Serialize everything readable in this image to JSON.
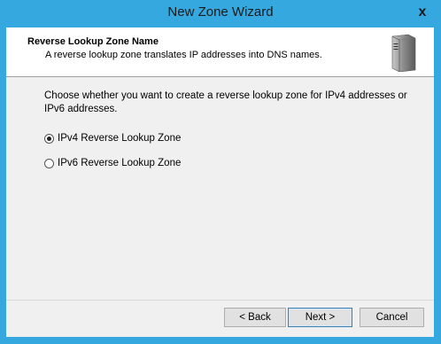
{
  "window": {
    "title": "New Zone Wizard",
    "close_glyph": "x"
  },
  "header": {
    "title": "Reverse Lookup Zone Name",
    "subtitle": "A reverse lookup zone translates IP addresses into DNS names.",
    "icon": "server-icon"
  },
  "main": {
    "prompt": "Choose whether you want to create a reverse lookup zone for IPv4 addresses or IPv6 addresses.",
    "options": [
      {
        "label": "IPv4 Reverse Lookup Zone",
        "selected": true
      },
      {
        "label": "IPv6 Reverse Lookup Zone",
        "selected": false
      }
    ]
  },
  "buttons": {
    "back": "< Back",
    "next": "Next >",
    "cancel": "Cancel"
  },
  "colors": {
    "titlebar": "#35a8e0",
    "client": "#f0f0f0",
    "header": "#ffffff"
  }
}
